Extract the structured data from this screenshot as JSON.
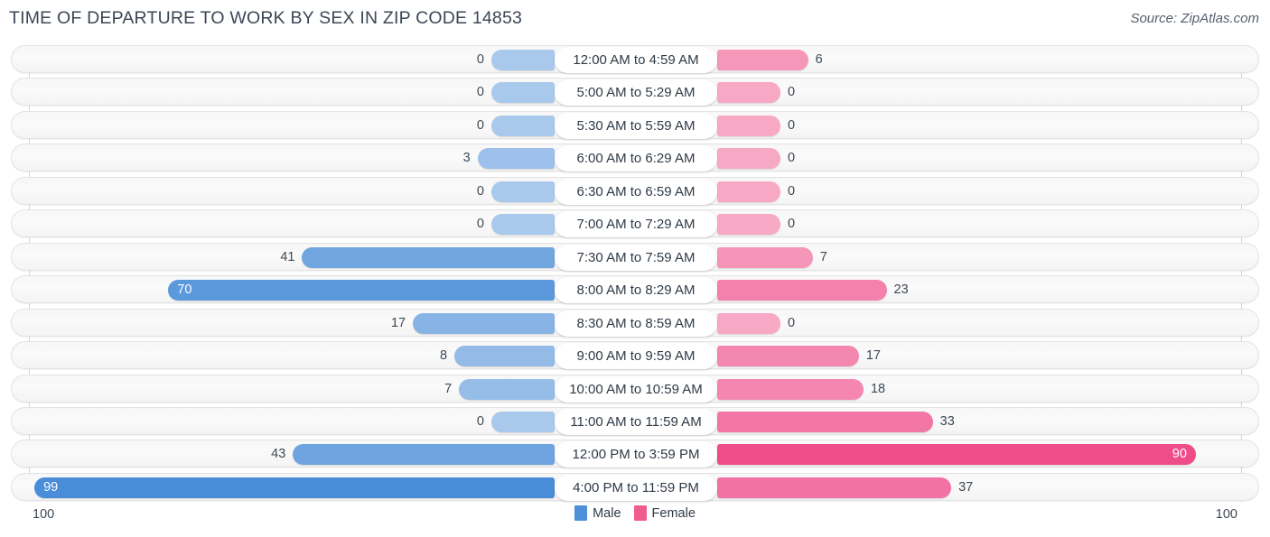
{
  "header": {
    "title": "TIME OF DEPARTURE TO WORK BY SEX IN ZIP CODE 14853",
    "source": "Source: ZipAtlas.com"
  },
  "axis": {
    "left_end_label": "100",
    "right_end_label": "100"
  },
  "legend": {
    "items": [
      {
        "label": "Male",
        "color": "#4d90d9"
      },
      {
        "label": "Female",
        "color": "#ef5c8e"
      }
    ]
  },
  "chart_data": {
    "type": "bar",
    "orientation": "horizontal-diverging",
    "title": "TIME OF DEPARTURE TO WORK BY SEX IN ZIP CODE 14853",
    "xlabel": "",
    "ylabel": "",
    "xlim": [
      100,
      100
    ],
    "grid": false,
    "legend_position": "bottom-center",
    "categories": [
      "12:00 AM to 4:59 AM",
      "5:00 AM to 5:29 AM",
      "5:30 AM to 5:59 AM",
      "6:00 AM to 6:29 AM",
      "6:30 AM to 6:59 AM",
      "7:00 AM to 7:29 AM",
      "7:30 AM to 7:59 AM",
      "8:00 AM to 8:29 AM",
      "8:30 AM to 8:59 AM",
      "9:00 AM to 9:59 AM",
      "10:00 AM to 10:59 AM",
      "11:00 AM to 11:59 AM",
      "12:00 PM to 3:59 PM",
      "4:00 PM to 11:59 PM"
    ],
    "series": [
      {
        "name": "Male",
        "color": "#4d90d9",
        "values": [
          0,
          0,
          0,
          3,
          0,
          0,
          41,
          70,
          17,
          8,
          7,
          0,
          43,
          99
        ]
      },
      {
        "name": "Female",
        "color": "#ef5c8e",
        "values": [
          6,
          0,
          0,
          0,
          0,
          0,
          7,
          23,
          0,
          17,
          18,
          33,
          90,
          37
        ]
      }
    ]
  },
  "rows": [
    {
      "category": "12:00 AM to 4:59 AM",
      "male": "0",
      "female": "6",
      "male_value": 0,
      "female_value": 6
    },
    {
      "category": "5:00 AM to 5:29 AM",
      "male": "0",
      "female": "0",
      "male_value": 0,
      "female_value": 0
    },
    {
      "category": "5:30 AM to 5:59 AM",
      "male": "0",
      "female": "0",
      "male_value": 0,
      "female_value": 0
    },
    {
      "category": "6:00 AM to 6:29 AM",
      "male": "3",
      "female": "0",
      "male_value": 3,
      "female_value": 0
    },
    {
      "category": "6:30 AM to 6:59 AM",
      "male": "0",
      "female": "0",
      "male_value": 0,
      "female_value": 0
    },
    {
      "category": "7:00 AM to 7:29 AM",
      "male": "0",
      "female": "0",
      "male_value": 0,
      "female_value": 0
    },
    {
      "category": "7:30 AM to 7:59 AM",
      "male": "41",
      "female": "7",
      "male_value": 41,
      "female_value": 7
    },
    {
      "category": "8:00 AM to 8:29 AM",
      "male": "70",
      "female": "23",
      "male_value": 70,
      "female_value": 23
    },
    {
      "category": "8:30 AM to 8:59 AM",
      "male": "17",
      "female": "0",
      "male_value": 17,
      "female_value": 0
    },
    {
      "category": "9:00 AM to 9:59 AM",
      "male": "8",
      "female": "17",
      "male_value": 8,
      "female_value": 17
    },
    {
      "category": "10:00 AM to 10:59 AM",
      "male": "7",
      "female": "18",
      "male_value": 7,
      "female_value": 18
    },
    {
      "category": "11:00 AM to 11:59 AM",
      "male": "0",
      "female": "33",
      "male_value": 0,
      "female_value": 33
    },
    {
      "category": "12:00 PM to 3:59 PM",
      "male": "43",
      "female": "90",
      "male_value": 43,
      "female_value": 90
    },
    {
      "category": "4:00 PM to 11:59 PM",
      "male": "99",
      "female": "37",
      "male_value": 99,
      "female_value": 37
    }
  ]
}
